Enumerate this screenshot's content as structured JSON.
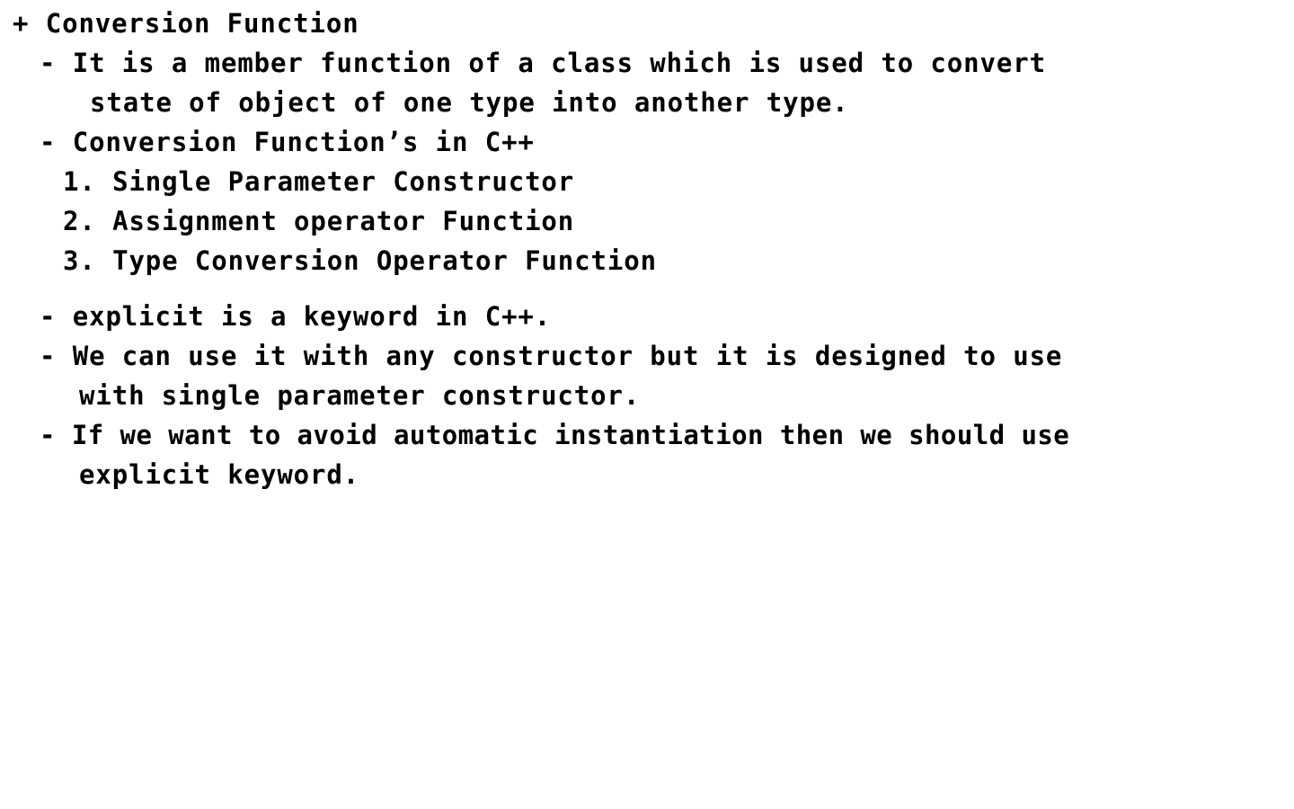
{
  "document": {
    "heading": "+ Conversion Function",
    "definition_line1": "- It is a member function of a class which is used to convert",
    "definition_line2": "state of object of one type into another type.",
    "types_heading": "- Conversion Function’s in C++",
    "types": [
      "1. Single Parameter Constructor",
      "2. Assignment operator Function",
      "3. Type Conversion Operator Function"
    ],
    "explicit_line": "- explicit is a keyword in C++.",
    "usage_line1": "- We can use it with any constructor but it is designed to use",
    "usage_line2": "with single parameter constructor.",
    "avoid_line1": "- If we want to avoid automatic instantiation then we should use",
    "avoid_line2": "explicit keyword."
  }
}
